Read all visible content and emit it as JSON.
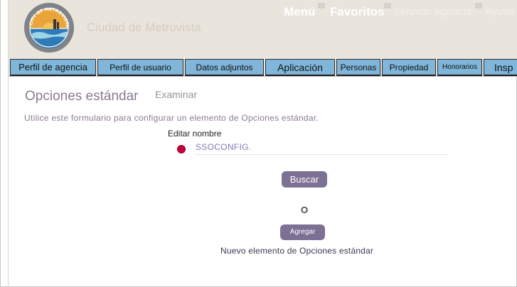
{
  "header": {
    "site_name": "Ciudad de Metrovista",
    "logo_text": "CITY OF METROVISTA",
    "nav": [
      "Menú",
      "Favoritos",
      "Servicio agencia",
      "Ayuda"
    ]
  },
  "tabs": [
    "Perfil de agencia",
    "Perfil de usuario",
    "Datos adjuntos",
    "Aplicación",
    "Personas",
    "Propiedad",
    "Honorarios",
    "Insp"
  ],
  "page": {
    "title": "Opciones estándar",
    "browse_link": "Examinar",
    "instructions": "Utilice este formulario para configurar un elemento de Opciones estándar.",
    "edit_label": "Editar nombre",
    "field_value": "SSOCONFIG.",
    "search_button": "Buscar",
    "or_text": "O",
    "add_button": "Agregar",
    "new_item_text": "Nuevo elemento de Opciones estándar"
  },
  "colors": {
    "tab_bg": "#7fb6da",
    "header_bg": "#e9e4dc",
    "button_bg": "#7c7094",
    "title_text": "#8a7a90",
    "radio": "#c4003a"
  }
}
